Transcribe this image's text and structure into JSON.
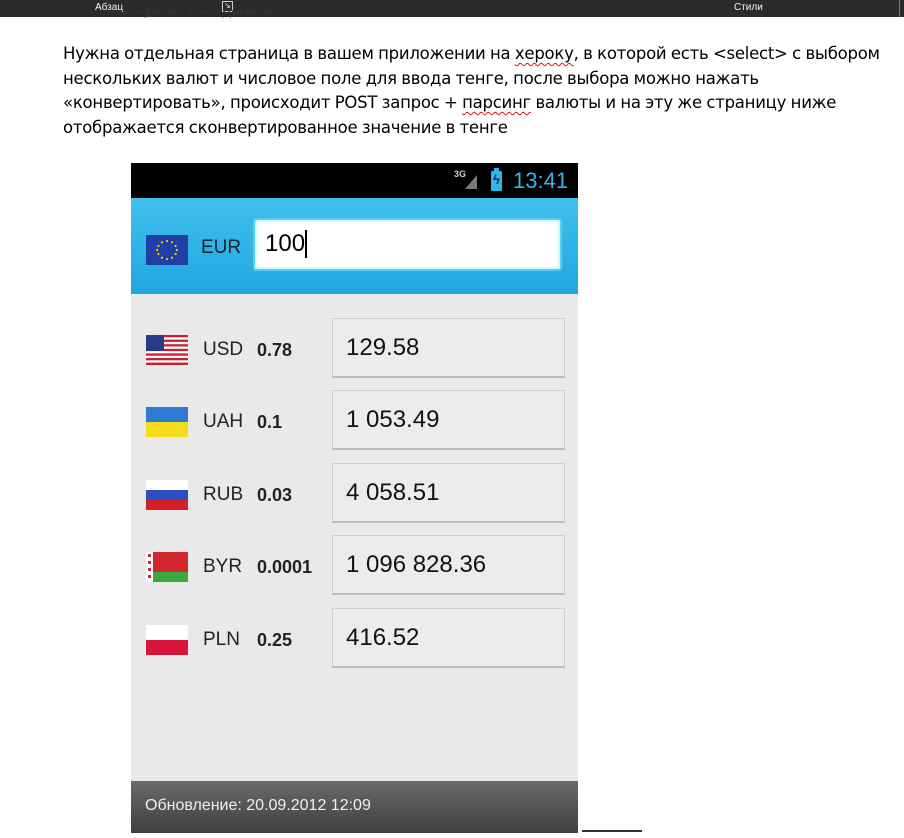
{
  "ribbon": {
    "paragraph_group": "Абзац",
    "styles_group": "Стили"
  },
  "document": {
    "cut_previous_line": "Что нужно что сделать:",
    "paragraph_before": "Нужна отдельная страница в вашем приложении на ",
    "squiggle_1": "хероку",
    "paragraph_middle": ", в которой есть <select> с выбором нескольких валют и числовое поле для ввода тенге, после выбора можно нажать «конвертировать», происходит POST запрос + ",
    "squiggle_2": "парсинг",
    "paragraph_after": " валюты и на эту же страницу ниже отображается сконвертированное значение в тенге"
  },
  "phone": {
    "status_bar": {
      "network": "3G",
      "time": "13:41",
      "icons": [
        "signal-icon",
        "battery-charging-icon"
      ]
    },
    "base": {
      "flag": "eu-flag-icon",
      "code": "EUR",
      "amount": "100"
    },
    "rows": [
      {
        "flag": "us-flag-icon",
        "code": "USD",
        "rate": "0.78",
        "value": "129.58"
      },
      {
        "flag": "ua-flag-icon",
        "code": "UAH",
        "rate": "0.1",
        "value": "1 053.49"
      },
      {
        "flag": "ru-flag-icon",
        "code": "RUB",
        "rate": "0.03",
        "value": "4 058.51"
      },
      {
        "flag": "by-flag-icon",
        "code": "BYR",
        "rate": "0.0001",
        "value": "1 096 828.36"
      },
      {
        "flag": "pl-flag-icon",
        "code": "PLN",
        "rate": "0.25",
        "value": "416.52"
      }
    ],
    "footer": "Обновление: 20.09.2012 12:09"
  },
  "colors": {
    "header_blue": "#29aee3",
    "status_blue": "#33b5e5",
    "spell_error": "#dd1111"
  }
}
